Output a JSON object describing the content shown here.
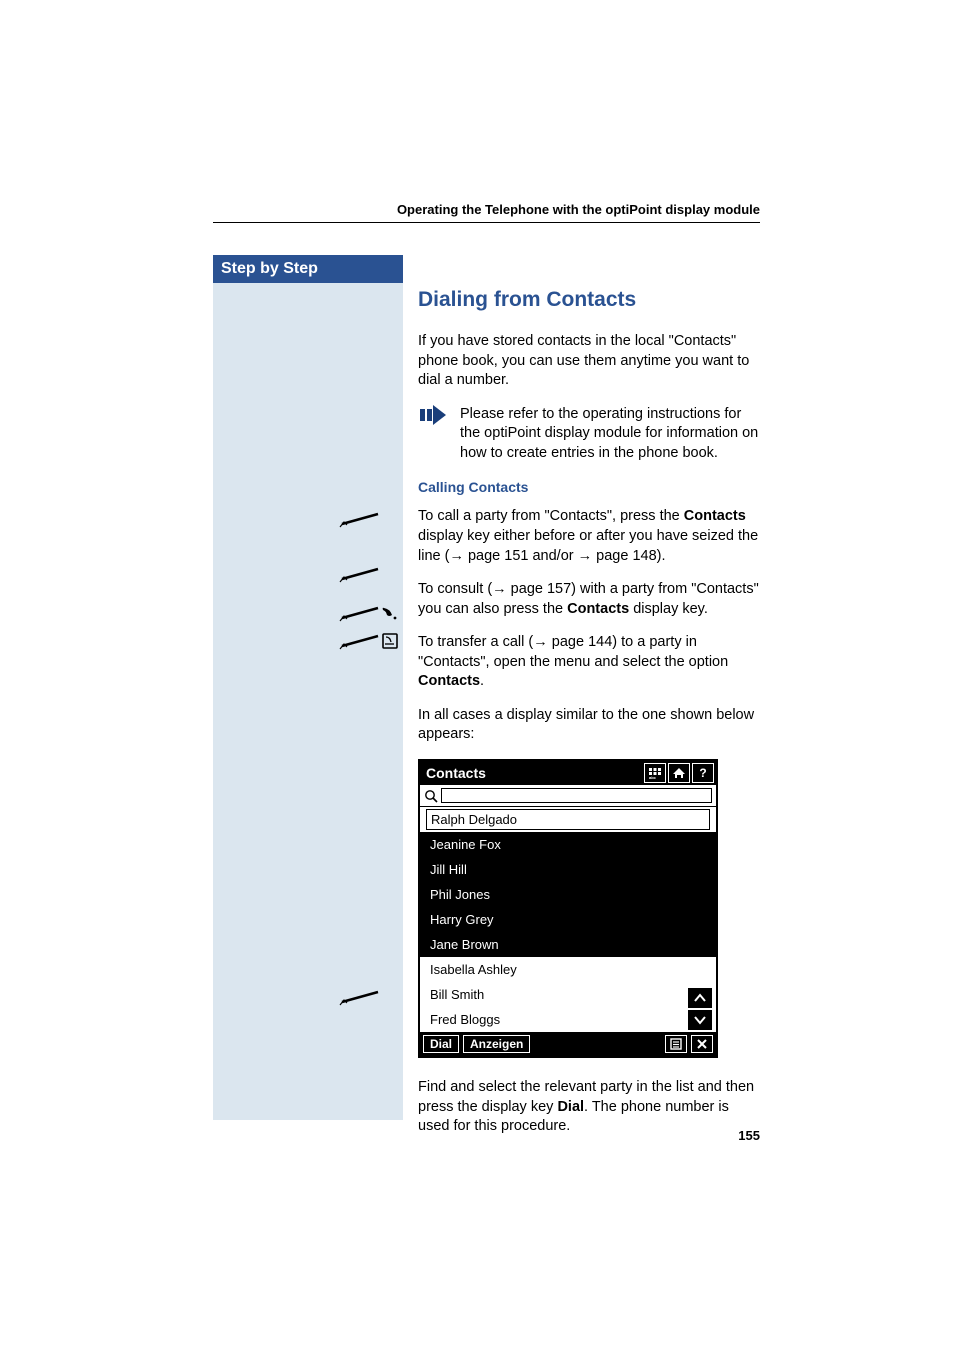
{
  "header": {
    "running_head": "Operating the Telephone with the optiPoint display module"
  },
  "sidebar": {
    "title": "Step by Step"
  },
  "section": {
    "title": "Dialing from Contacts",
    "intro": "If you have stored contacts in the local \"Contacts\" phone book, you can use them anytime you want to dial a number.",
    "note": "Please refer to the operating instructions for the optiPoint display module for information on how to create entries in the phone book.",
    "subhead": "Calling Contacts",
    "p1_a": "To call a party from \"Contacts\", press the ",
    "p1_b": "Contacts",
    "p1_c": " display key  either before or after you have seized the line (",
    "p1_d": " page 151 and/or ",
    "p1_e": " page 148).",
    "p2_a": "To consult (",
    "p2_b": " page 157) with a party from \"Contacts\" you can also press the ",
    "p2_c": "Contacts",
    "p2_d": " display key.",
    "p3_a": "To transfer a call (",
    "p3_b": " page 144) to a party in \"Contacts\", open the menu and select the option ",
    "p3_c": "Contacts",
    "p3_d": ".",
    "p4": "In all cases a display similar to the one shown below appears:",
    "p5_a": "Find and select the relevant party in the list and then press the display key ",
    "p5_b": "Dial",
    "p5_c": ". The phone number is used for this procedure."
  },
  "phone": {
    "title": "Contacts",
    "topicons": [
      "keypad",
      "home",
      "?"
    ],
    "list": [
      "Ralph Delgado",
      "Jeanine Fox",
      "Jill Hill",
      "Phil Jones",
      "Harry Grey",
      "Jane Brown",
      "Isabella Ashley",
      "Bill Smith",
      "Fred Bloggs"
    ],
    "softkeys": {
      "left1": "Dial",
      "left2": "Anzeigen",
      "right1": "menu",
      "right2": "×"
    }
  },
  "page_number": "155"
}
